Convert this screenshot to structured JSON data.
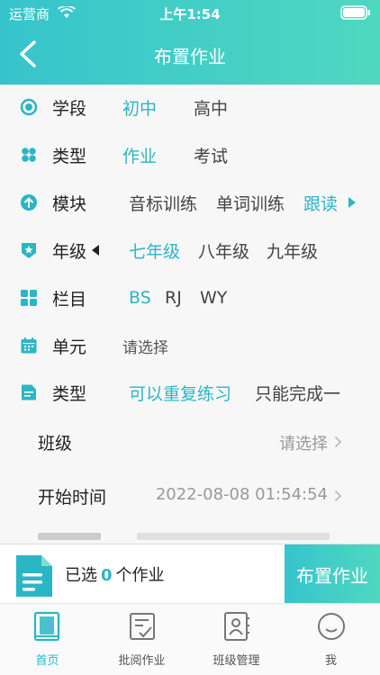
{
  "status": {
    "carrier": "运营商",
    "time": "上午1:54"
  },
  "nav": {
    "title": "布置作业"
  },
  "form": {
    "stage": {
      "label": "学段",
      "options": [
        "初中",
        "高中"
      ]
    },
    "type": {
      "label": "类型",
      "options": [
        "作业",
        "考试"
      ]
    },
    "module": {
      "label": "模块",
      "options": [
        "音标训练",
        "单词训练",
        "跟读"
      ]
    },
    "grade": {
      "label": "年级",
      "options": [
        "七年级",
        "八年级",
        "九年级"
      ]
    },
    "column": {
      "label": "栏目",
      "options": [
        "BS",
        "RJ",
        "WY"
      ]
    },
    "unit": {
      "label": "单元",
      "value": "请选择"
    },
    "practice": {
      "label": "类型",
      "options": [
        "可以重复练习",
        "只能完成一"
      ]
    },
    "class": {
      "label": "班级",
      "value": "请选择"
    },
    "start": {
      "label": "开始时间",
      "value": "2022-08-08 01:54:54"
    }
  },
  "bottom": {
    "prefix": "已选",
    "count": "0",
    "suffix": "个作业",
    "button": "布置作业"
  },
  "tabs": [
    {
      "label": "首页"
    },
    {
      "label": "批阅作业"
    },
    {
      "label": "班级管理"
    },
    {
      "label": "我"
    }
  ],
  "colors": {
    "accent": "#2bb6c4",
    "header_start": "#36c4cc",
    "header_end": "#4fd8c0"
  }
}
